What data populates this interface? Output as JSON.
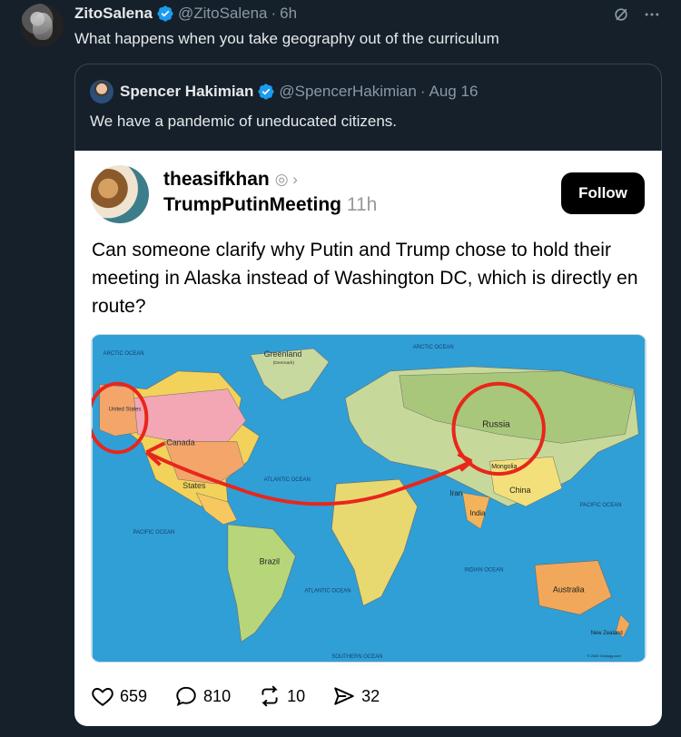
{
  "tweet": {
    "author_name": "ZitoSalena",
    "handle": "@ZitoSalena",
    "separator": "·",
    "time": "6h",
    "text": "What happens when you take geography out of the curriculum"
  },
  "quote": {
    "author_name": "Spencer Hakimian",
    "handle": "@SpencerHakimian",
    "separator": "·",
    "date": "Aug 16",
    "text": "We have a pandemic of uneducated citizens."
  },
  "embedded_post": {
    "username": "theasifkhan",
    "community": "TrumpPutinMeeting",
    "time": "11h",
    "follow_label": "Follow",
    "text": "Can someone clarify why Putin and Trump chose to hold their meeting in Alaska instead of Washington DC, which is directly en route?",
    "stats": {
      "likes": "659",
      "replies": "810",
      "reposts": "10",
      "shares": "32"
    }
  },
  "map": {
    "labels": {
      "arctic_left": "ARCTIC OCEAN",
      "arctic_right": "ARCTIC OCEAN",
      "greenland": "Greenland",
      "greenland_sub": "(Denmark)",
      "united_states_alaska": "United States",
      "canada": "Canada",
      "united_states": "States",
      "russia": "Russia",
      "mongolia": "Mongolia",
      "china": "China",
      "iran": "Iran",
      "india": "India",
      "atlantic_north": "ATLANTIC OCEAN",
      "atlantic_south": "ATLANTIC OCEAN",
      "pacific_left": "PACIFIC OCEAN",
      "pacific_right": "PACIFIC OCEAN",
      "indian_ocean": "INDIAN OCEAN",
      "southern_ocean": "SOUTHERN OCEAN",
      "brazil": "Brazil",
      "australia": "Australia",
      "new_zealand": "New Zealand",
      "copyright": "© 2020 Geology.com"
    }
  },
  "colors": {
    "background": "#15202b",
    "verified": "#1d9bf0",
    "ocean": "#2f9fd6",
    "annotation_red": "#e8261c"
  },
  "icons": {
    "verified": "verified-badge-icon",
    "grok": "grok-icon",
    "more": "more-icon",
    "like": "heart-icon",
    "reply": "comment-icon",
    "repost": "repost-icon",
    "share": "send-icon"
  }
}
